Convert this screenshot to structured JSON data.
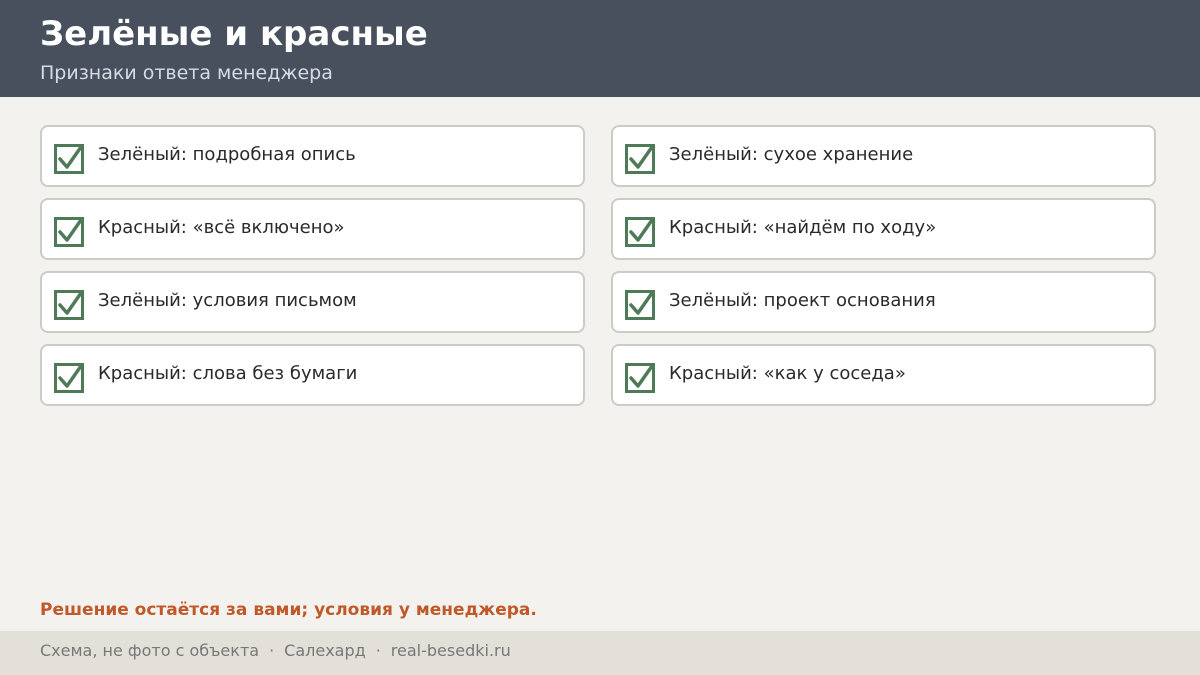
{
  "header": {
    "title": "Зелёные и красные",
    "subtitle": "Признаки ответа менеджера"
  },
  "items": [
    {
      "label": "Зелёный: подробная опись",
      "icon": "checkbox-checked-icon"
    },
    {
      "label": "Зелёный: сухое хранение",
      "icon": "checkbox-checked-icon"
    },
    {
      "label": "Красный: «всё включено»",
      "icon": "checkbox-checked-icon"
    },
    {
      "label": "Красный: «найдём по ходу»",
      "icon": "checkbox-checked-icon"
    },
    {
      "label": "Зелёный: условия письмом",
      "icon": "checkbox-checked-icon"
    },
    {
      "label": "Зелёный: проект основания",
      "icon": "checkbox-checked-icon"
    },
    {
      "label": "Красный: слова без бумаги",
      "icon": "checkbox-checked-icon"
    },
    {
      "label": "Красный: «как у соседа»",
      "icon": "checkbox-checked-icon"
    }
  ],
  "note": "Решение остаётся за вами; условия у менеджера.",
  "footer": {
    "caption": "Схема, не фото с объекта",
    "separator": "·",
    "city": "Салехард",
    "site": "real-besedki.ru"
  },
  "colors": {
    "header_bg": "#47505c",
    "page_bg": "#f4f2ee",
    "check": "#4f7a58",
    "note": "#c0592a",
    "footer_bg": "#e3e0da"
  }
}
